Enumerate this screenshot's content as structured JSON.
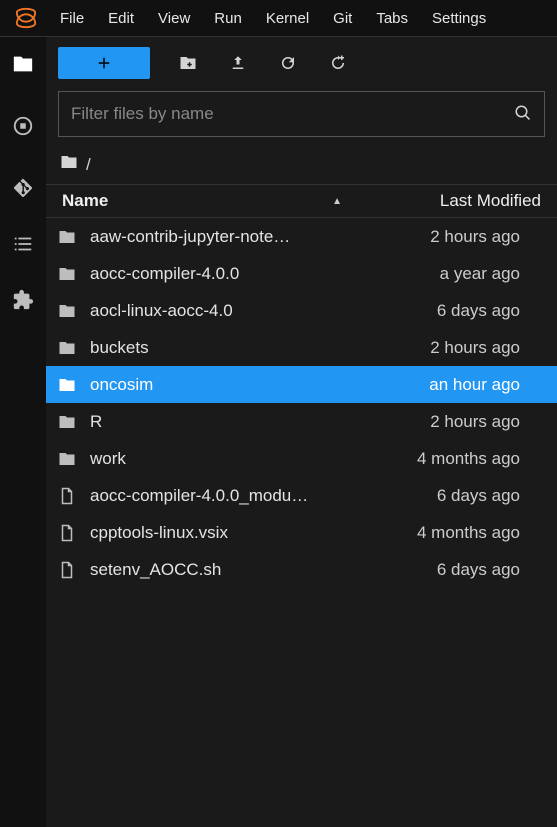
{
  "menu": [
    "File",
    "Edit",
    "View",
    "Run",
    "Kernel",
    "Git",
    "Tabs",
    "Settings"
  ],
  "search": {
    "placeholder": "Filter files by name"
  },
  "breadcrumb": {
    "root": "/"
  },
  "columns": {
    "name": "Name",
    "modified": "Last Modified"
  },
  "files": [
    {
      "name": "aaw-contrib-jupyter-note…",
      "type": "folder",
      "modified": "2 hours ago",
      "selected": false
    },
    {
      "name": "aocc-compiler-4.0.0",
      "type": "folder",
      "modified": "a year ago",
      "selected": false
    },
    {
      "name": "aocl-linux-aocc-4.0",
      "type": "folder",
      "modified": "6 days ago",
      "selected": false
    },
    {
      "name": "buckets",
      "type": "folder",
      "modified": "2 hours ago",
      "selected": false
    },
    {
      "name": "oncosim",
      "type": "folder",
      "modified": "an hour ago",
      "selected": true
    },
    {
      "name": "R",
      "type": "folder",
      "modified": "2 hours ago",
      "selected": false
    },
    {
      "name": "work",
      "type": "folder",
      "modified": "4 months ago",
      "selected": false
    },
    {
      "name": "aocc-compiler-4.0.0_modu…",
      "type": "file",
      "modified": "6 days ago",
      "selected": false
    },
    {
      "name": "cpptools-linux.vsix",
      "type": "file",
      "modified": "4 months ago",
      "selected": false
    },
    {
      "name": "setenv_AOCC.sh",
      "type": "file",
      "modified": "6 days ago",
      "selected": false
    }
  ]
}
